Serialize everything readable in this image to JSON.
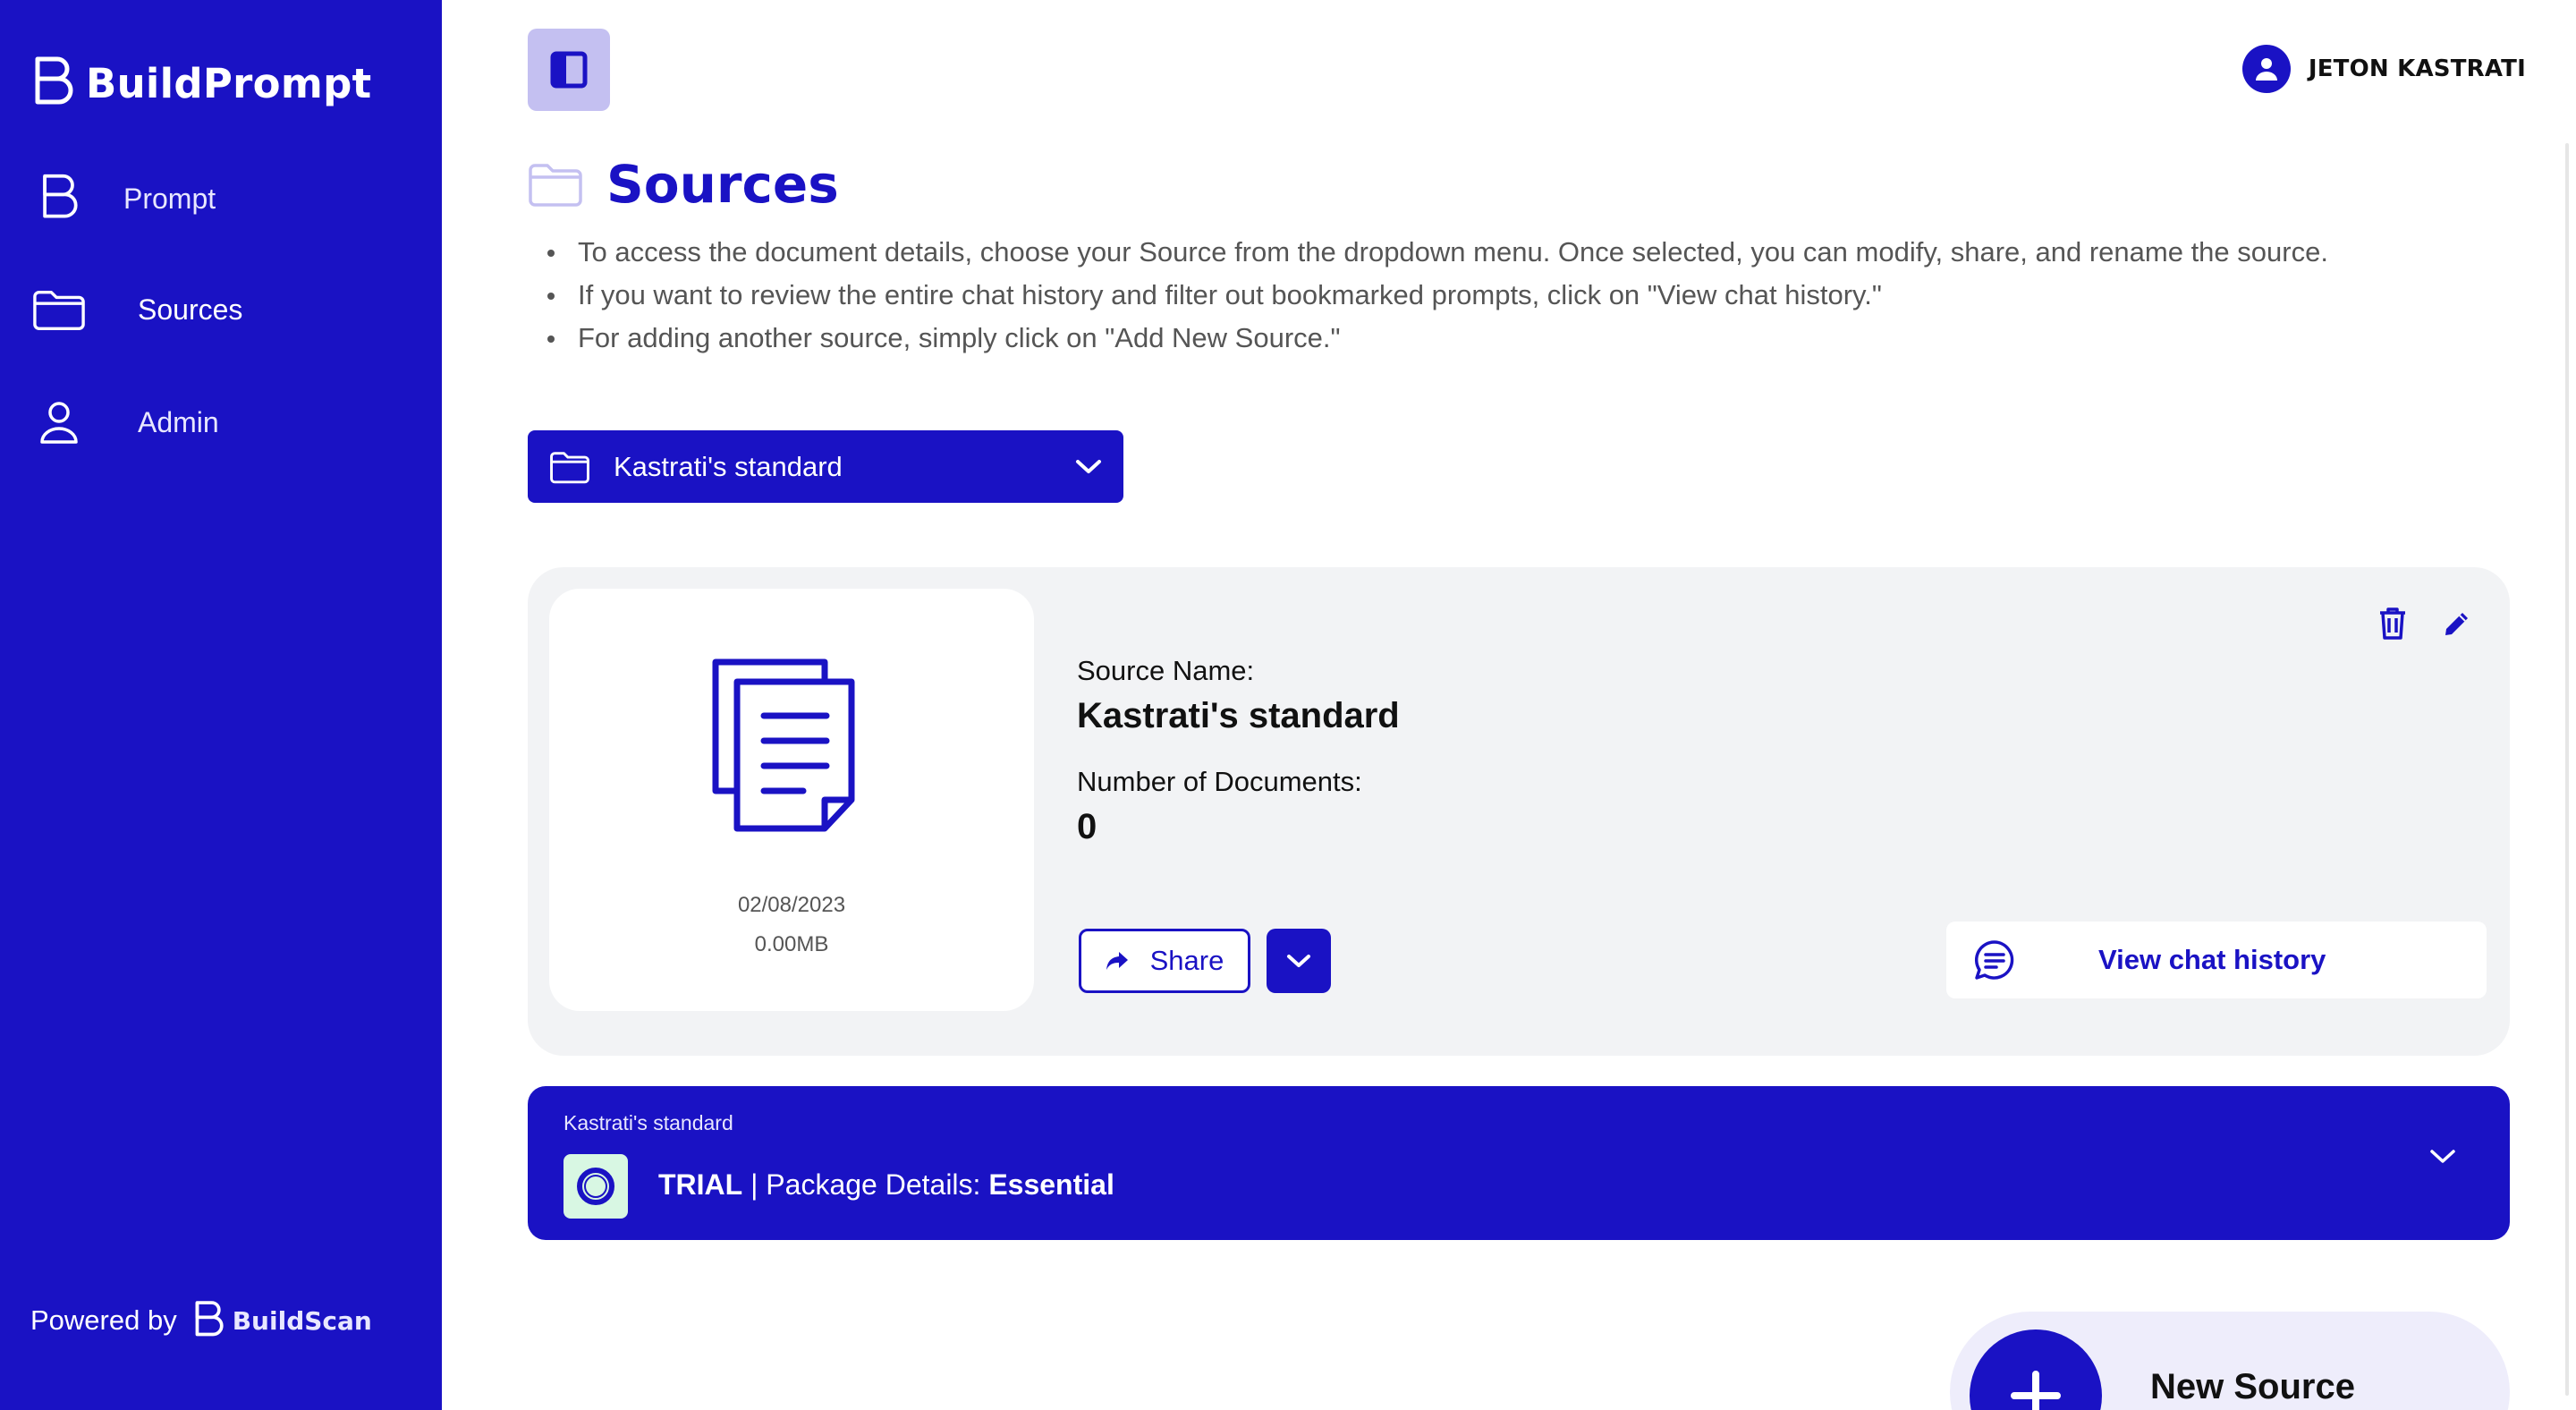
{
  "app": {
    "brand_name": "BuildPrompt"
  },
  "sidebar": {
    "items": [
      {
        "label": "Prompt",
        "icon": "buildprompt-logo-icon"
      },
      {
        "label": "Sources",
        "icon": "folder-icon",
        "active": true
      },
      {
        "label": "Admin",
        "icon": "user-icon"
      }
    ],
    "powered_by": "Powered by",
    "powered_brand": "BuildScan"
  },
  "header": {
    "user_name": "JETON KASTRATI"
  },
  "page": {
    "title": "Sources",
    "instructions": [
      "To access the document details, choose your Source from the dropdown menu. Once selected, you can modify, share, and rename the source.",
      "If you want to review the entire chat history and filter out bookmarked prompts, click on \"View chat history.\"",
      "For adding another source, simply click on \"Add New Source.\""
    ]
  },
  "source_select": {
    "selected": "Kastrati's standard"
  },
  "source_card": {
    "date": "02/08/2023",
    "size": "0.00MB",
    "source_name_label": "Source Name:",
    "source_name": "Kastrati's standard",
    "num_docs_label": "Number of Documents:",
    "num_docs": "0",
    "share_label": "Share",
    "chat_history_label": "View chat history"
  },
  "package": {
    "source": "Kastrati's standard",
    "status": "TRIAL",
    "details_label": "| Package Details:",
    "plan": "Essential"
  },
  "new_source": {
    "label": "New Source"
  },
  "colors": {
    "primary": "#1a12c4",
    "card_bg": "#f2f3f5",
    "toggle_bg": "#c4c0f1",
    "badge_bg": "#d8f7e3"
  }
}
